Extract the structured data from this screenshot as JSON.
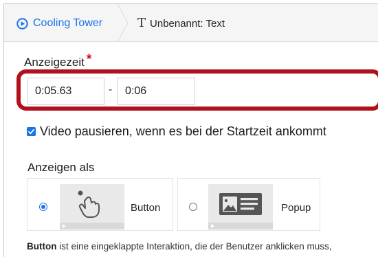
{
  "breadcrumb": {
    "items": [
      {
        "label": "Cooling Tower",
        "icon": "play-circle-icon"
      },
      {
        "label": "Unbenannt: Text",
        "icon": "text-t-icon"
      }
    ]
  },
  "display_time": {
    "label": "Anzeigezeit",
    "required_mark": "*",
    "start_value": "0:05.63",
    "separator": "-",
    "end_value": "0:06"
  },
  "pause_checkbox": {
    "checked": true,
    "label": "Video pausieren, wenn es bei der Startzeit ankommt"
  },
  "display_as": {
    "label": "Anzeigen als",
    "options": [
      {
        "label": "Button",
        "selected": true,
        "icon": "tap-gesture-icon"
      },
      {
        "label": "Popup",
        "selected": false,
        "icon": "popup-card-icon"
      }
    ]
  },
  "description": {
    "bold": "Button",
    "text": "ist eine eingeklappte Interaktion, die der Benutzer anklicken muss,"
  },
  "colors": {
    "accent": "#1a73e8",
    "highlight": "#b3101e",
    "required": "#d6001c"
  }
}
